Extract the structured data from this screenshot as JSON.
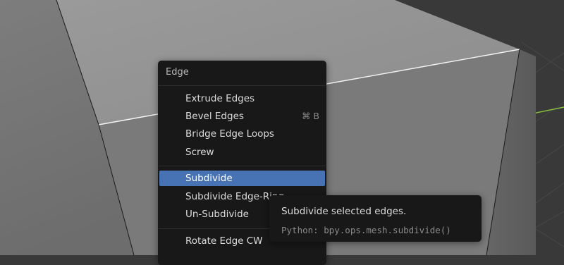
{
  "menu": {
    "title": "Edge",
    "items": [
      {
        "label": "Extrude Edges",
        "shortcut": ""
      },
      {
        "label": "Bevel Edges",
        "shortcut": "⌘ B"
      },
      {
        "label": "Bridge Edge Loops",
        "shortcut": ""
      },
      {
        "label": "Screw",
        "shortcut": ""
      },
      {
        "label": "Subdivide",
        "shortcut": "",
        "highlighted": true
      },
      {
        "label": "Subdivide Edge-Ring",
        "shortcut": ""
      },
      {
        "label": "Un-Subdivide",
        "shortcut": ""
      },
      {
        "label": "Rotate Edge CW",
        "shortcut": ""
      }
    ]
  },
  "tooltip": {
    "description": "Subdivide selected edges.",
    "python": "Python: bpy.ops.mesh.subdivide()"
  },
  "colors": {
    "highlight": "#4772b3",
    "menu_bg": "#181818",
    "axis_x": "#8ac03f",
    "viewport_bg": "#393939"
  }
}
